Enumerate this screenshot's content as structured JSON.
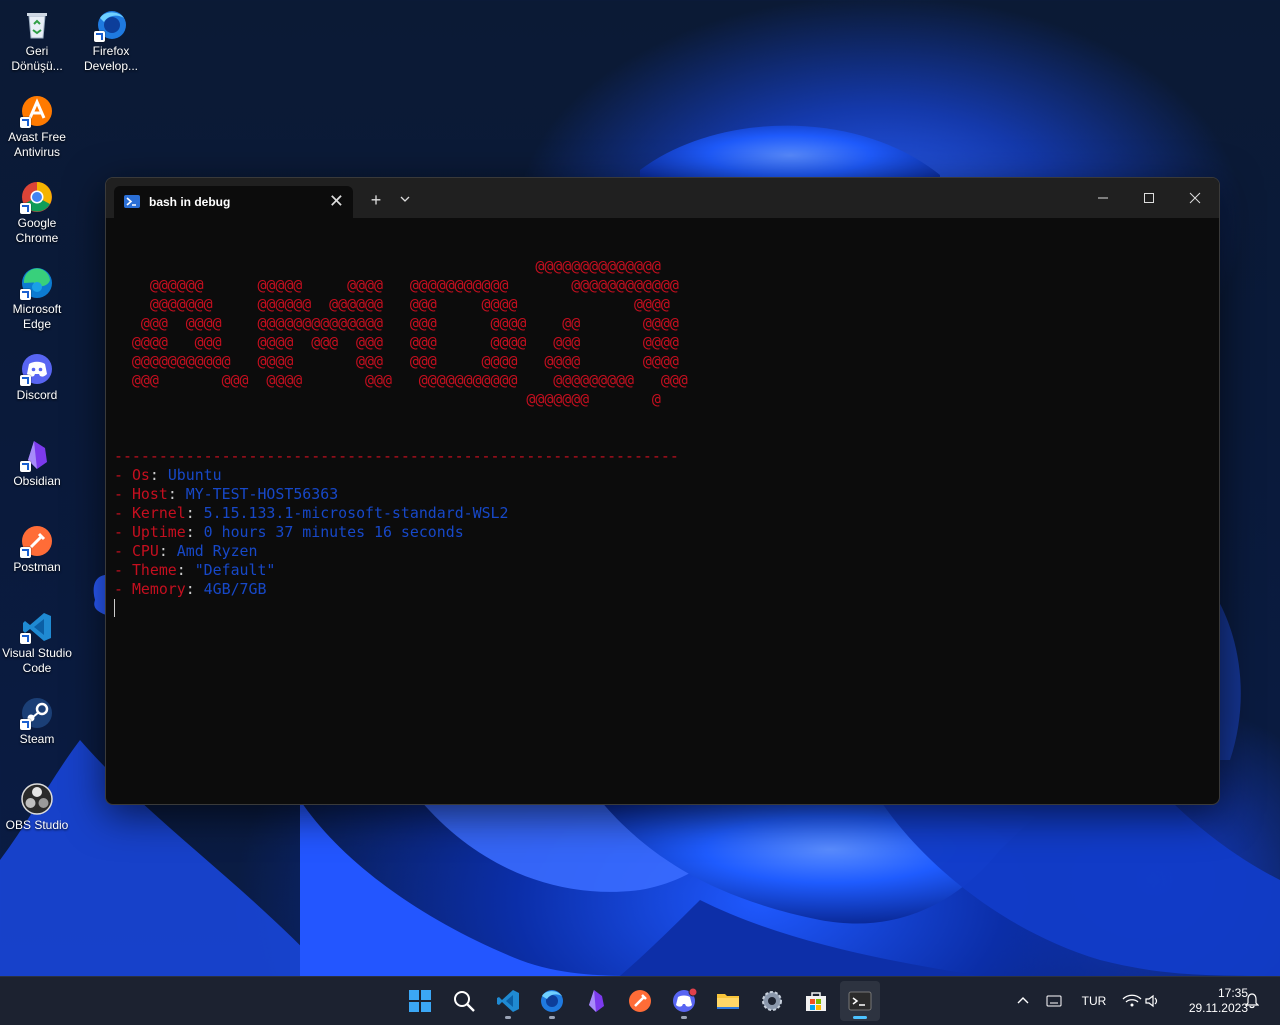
{
  "desktop": {
    "icons": [
      {
        "label_line1": "Geri",
        "label_line2": "Dönüşü...",
        "icon": "recycle-bin-icon"
      },
      {
        "label_line1": "Firefox",
        "label_line2": "Develop...",
        "icon": "firefox-developer-icon"
      },
      {
        "label_line1": "Avast Free",
        "label_line2": "Antivirus",
        "icon": "avast-icon"
      },
      {
        "label_line1": "Google",
        "label_line2": "Chrome",
        "icon": "chrome-icon"
      },
      {
        "label_line1": "Microsoft",
        "label_line2": "Edge",
        "icon": "edge-icon"
      },
      {
        "label_line1": "Discord",
        "label_line2": "",
        "icon": "discord-icon"
      },
      {
        "label_line1": "Obsidian",
        "label_line2": "",
        "icon": "obsidian-icon"
      },
      {
        "label_line1": "Postman",
        "label_line2": "",
        "icon": "postman-icon"
      },
      {
        "label_line1": "Visual Studio",
        "label_line2": "Code",
        "icon": "vscode-icon"
      },
      {
        "label_line1": "Steam",
        "label_line2": "",
        "icon": "steam-icon"
      },
      {
        "label_line1": "OBS Studio",
        "label_line2": "",
        "icon": "obs-icon"
      }
    ]
  },
  "terminal": {
    "tab_title": "bash in debug",
    "tab_close": "✕",
    "new_tab": "+",
    "dropdown": "⌄",
    "logo_lines": [
      "                                               @@@@@@@@@@@@@@",
      "    @@@@@@      @@@@@     @@@@   @@@@@@@@@@@       @@@@@@@@@@@@",
      "    @@@@@@@     @@@@@@  @@@@@@   @@@     @@@@             @@@@",
      "   @@@  @@@@    @@@@@@@@@@@@@@   @@@      @@@@    @@       @@@@",
      "  @@@@   @@@    @@@@  @@@  @@@   @@@      @@@@   @@@       @@@@",
      "  @@@@@@@@@@@   @@@@       @@@   @@@     @@@@   @@@@       @@@@",
      "  @@@       @@@  @@@@       @@@   @@@@@@@@@@@    @@@@@@@@@   @@@",
      "                                              @@@@@@@       @"
    ],
    "separator": "---------------------------------------------------------------",
    "info": [
      {
        "key": "Os",
        "value": "Ubuntu"
      },
      {
        "key": "Host",
        "value": "MY-TEST-HOST56363"
      },
      {
        "key": "Kernel",
        "value": "5.15.133.1-microsoft-standard-WSL2"
      },
      {
        "key": "Uptime",
        "value": "0 hours 37 minutes 16 seconds"
      },
      {
        "key": "CPU",
        "value": "Amd Ryzen"
      },
      {
        "key": "Theme",
        "value": "\"Default\""
      },
      {
        "key": "Memory",
        "value": "4GB/7GB"
      }
    ],
    "prefix": "- ",
    "colon": ": "
  },
  "taskbar": {
    "apps": [
      "start-icon",
      "search-icon",
      "vscode-icon",
      "firefox-developer-icon",
      "obsidian-icon",
      "postman-icon",
      "discord-icon",
      "file-explorer-icon",
      "settings-icon",
      "microsoft-store-icon",
      "terminal-icon"
    ],
    "language": "TUR",
    "time": "17:35",
    "date": "29.11.2023"
  },
  "colors": {
    "terminal_bg": "#0c0c0c",
    "red": "#c50f1f",
    "blue": "#1748c8",
    "accent": "#4cc2ff"
  }
}
